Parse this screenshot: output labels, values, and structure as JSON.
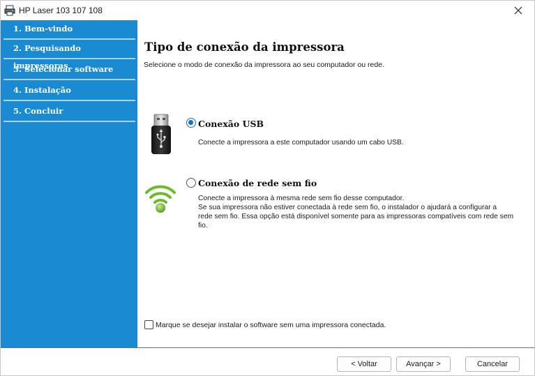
{
  "window": {
    "title": "HP Laser 103 107 108"
  },
  "sidebar": {
    "steps": [
      {
        "label": "1. Bem-vindo"
      },
      {
        "label": "2. Pesquisando impressoras"
      },
      {
        "label": "3. Selecionar software"
      },
      {
        "label": "4. Instalação"
      },
      {
        "label": "5. Concluir"
      }
    ]
  },
  "main": {
    "heading": "Tipo de conexão da impressora",
    "subtitle": "Selecione o modo de conexão da impressora ao seu computador ou rede.",
    "options": [
      {
        "label": "Conexão USB",
        "description": [
          "Conecte a impressora a este computador usando um cabo USB."
        ],
        "selected": true,
        "icon": "usb-icon"
      },
      {
        "label": "Conexão de rede sem fio",
        "description": [
          "Conecte a impressora à mesma rede sem fio desse computador.",
          "Se sua impressora não estiver conectada à rede sem fio, o instalador o ajudará a configurar a",
          "rede sem fio. Essa opção está disponível somente para as impressoras compatíveis com rede sem",
          "fio."
        ],
        "selected": false,
        "icon": "wifi-icon"
      }
    ],
    "checkbox_label": "Marque se desejar instalar o software sem uma impressora conectada.",
    "checkbox_checked": false
  },
  "footer": {
    "back_label": "< Voltar",
    "next_label": "Avançar >",
    "cancel_label": "Cancelar"
  },
  "colors": {
    "sidebar_bg": "#1a8ad3",
    "accent": "#1a6fd0",
    "wifi_green": "#6dbb2c"
  }
}
